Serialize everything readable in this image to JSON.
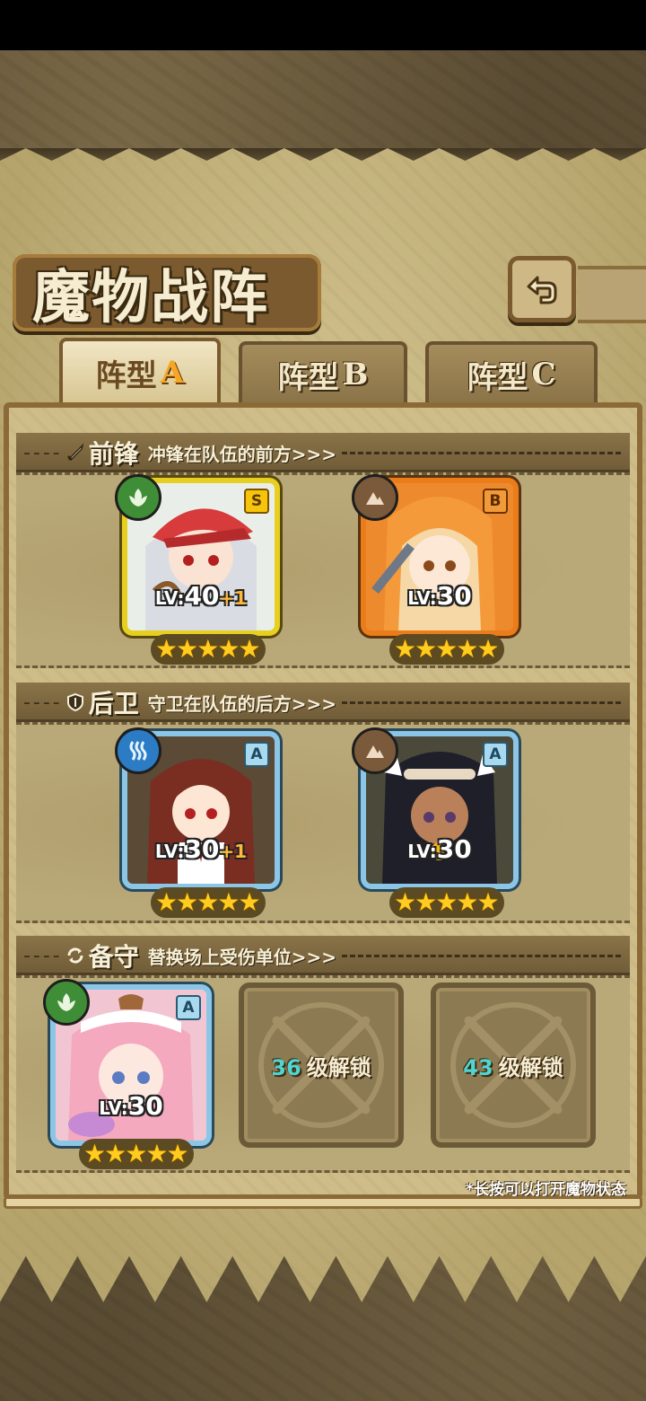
{
  "header": {
    "title": "魔物战阵",
    "back_icon": "back-arrow-icon"
  },
  "tabs": [
    {
      "label": "阵型",
      "letter": "A",
      "active": true
    },
    {
      "label": "阵型",
      "letter": "B",
      "active": false
    },
    {
      "label": "阵型",
      "letter": "C",
      "active": false
    }
  ],
  "sections": {
    "front": {
      "name": "前锋",
      "desc": "冲锋在队伍的前方>>>",
      "icon": "sword-icon"
    },
    "back": {
      "name": "后卫",
      "desc": "守卫在队伍的后方>>>",
      "icon": "shield-icon"
    },
    "reserve": {
      "name": "备守",
      "desc": "替换场上受伤单位>>>",
      "icon": "swap-icon"
    }
  },
  "cards": {
    "front1": {
      "rank": "S",
      "level": "40",
      "bonus": "+1",
      "element": "nature",
      "badge": "4",
      "stars": 5
    },
    "front2": {
      "rank": "B",
      "level": "30",
      "bonus": "",
      "element": "earth",
      "stars": 5
    },
    "back1": {
      "rank": "A",
      "level": "30",
      "bonus": "+1",
      "element": "water",
      "stars": 5
    },
    "back2": {
      "rank": "A",
      "level": "30",
      "bonus": "",
      "element": "earth",
      "stars": 5
    },
    "reserve1": {
      "rank": "A",
      "level": "30",
      "bonus": "",
      "element": "nature",
      "stars": 5
    }
  },
  "lv_prefix": "LV:",
  "locked": [
    {
      "level": "36",
      "text": "级解锁"
    },
    {
      "level": "43",
      "text": "级解锁"
    }
  ],
  "hint": "*长按可以打开魔物状态",
  "colors": {
    "accent": "#f5a623",
    "parchment": "#cfbd89",
    "frame": "#8b6a37"
  }
}
